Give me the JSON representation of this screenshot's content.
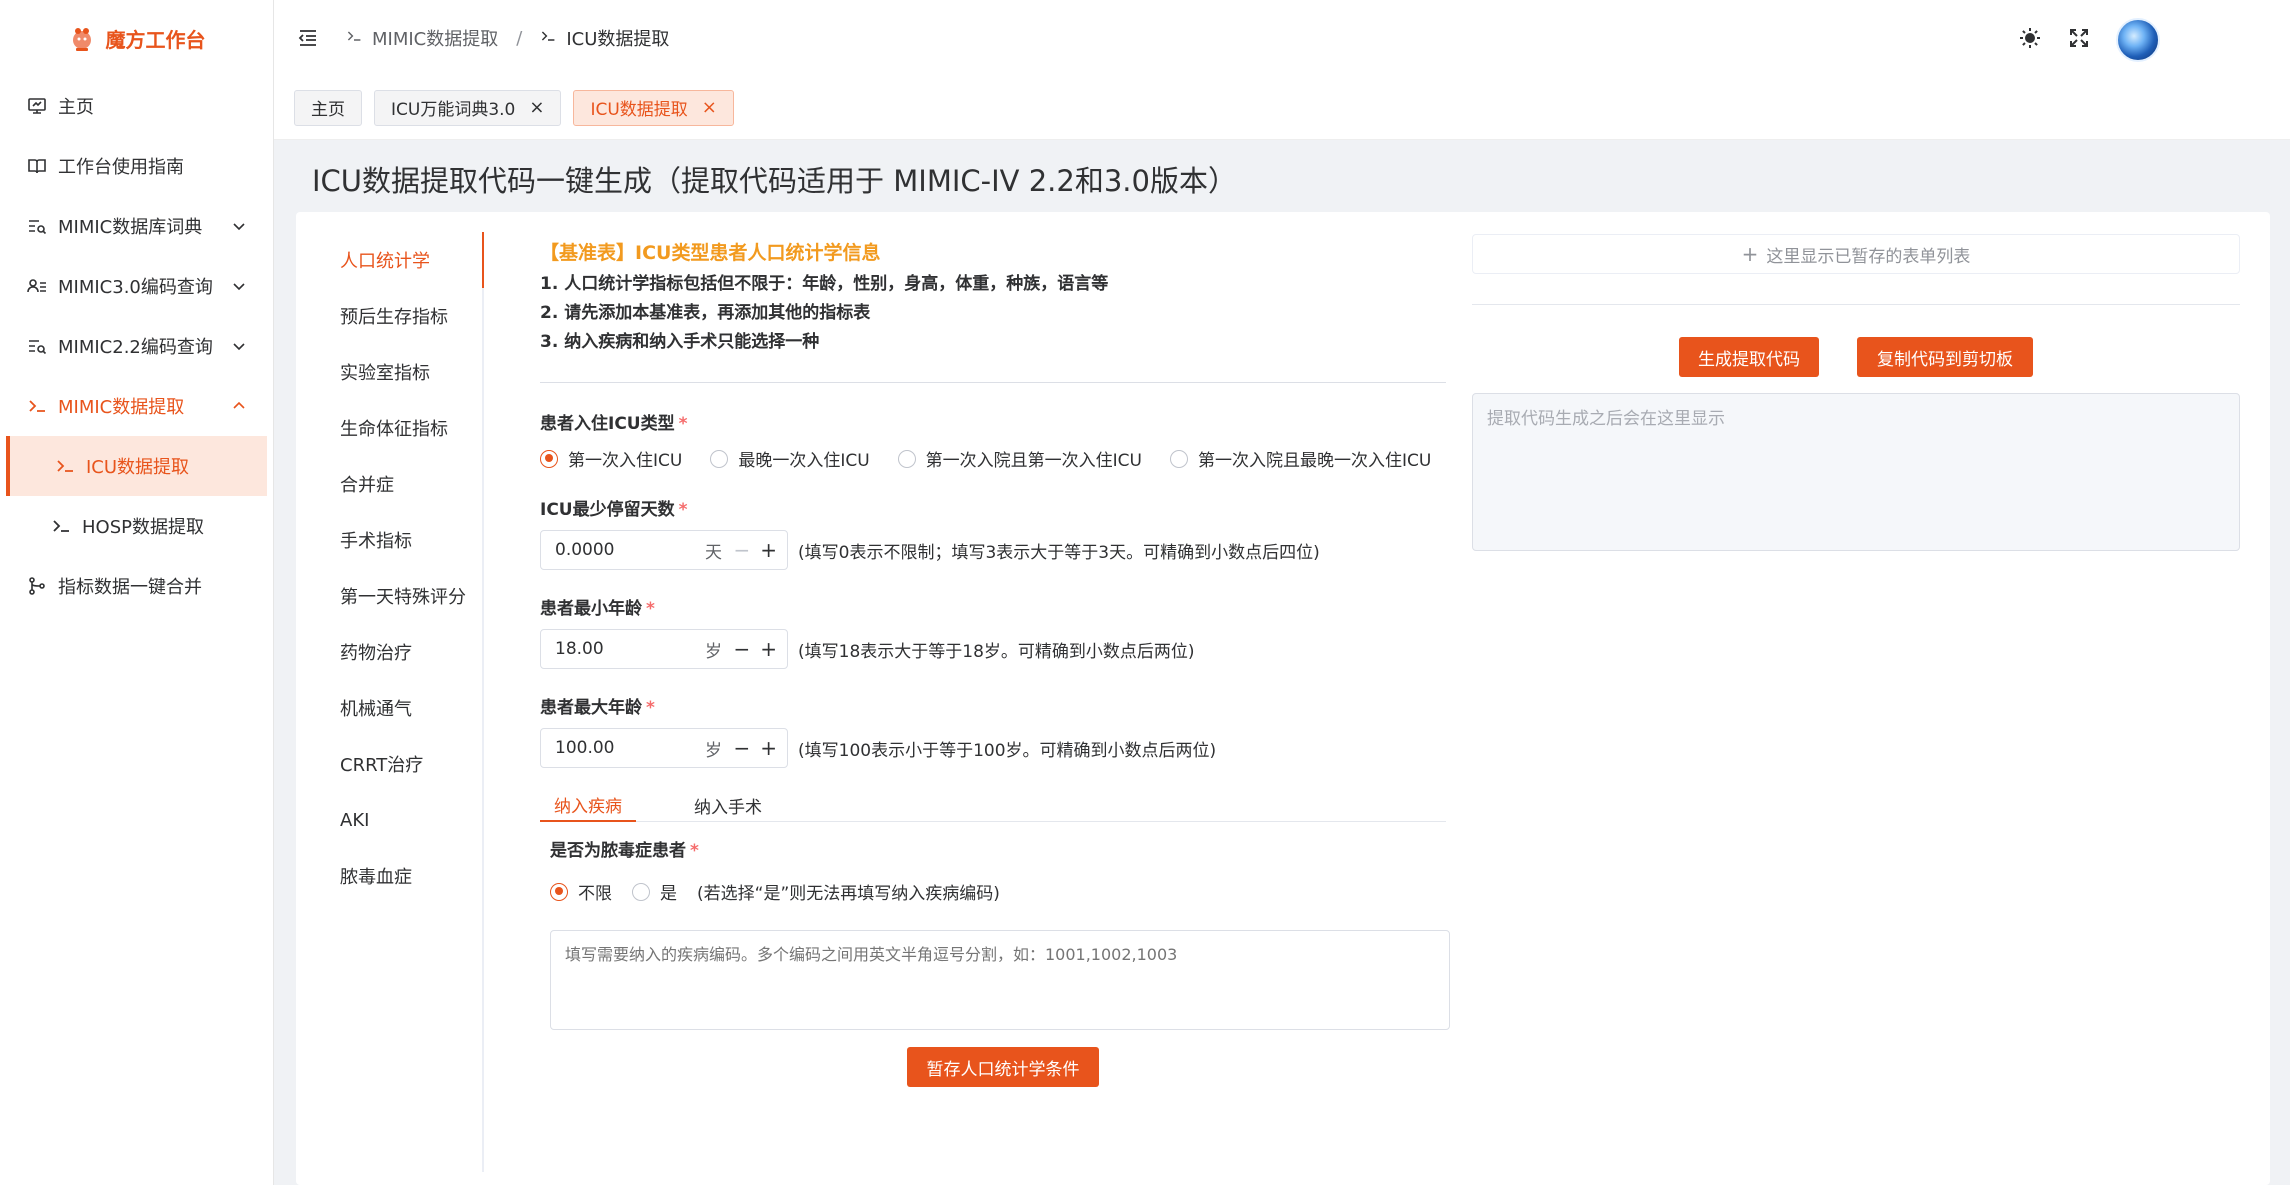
{
  "app": {
    "title": "魔方工作台"
  },
  "sidebar": {
    "items": [
      {
        "label": "主页"
      },
      {
        "label": "工作台使用指南"
      },
      {
        "label": "MIMIC数据库词典"
      },
      {
        "label": "MIMIC3.0编码查询"
      },
      {
        "label": "MIMIC2.2编码查询"
      },
      {
        "label": "MIMIC数据提取"
      },
      {
        "label": "ICU数据提取"
      },
      {
        "label": "HOSP数据提取"
      },
      {
        "label": "指标数据一键合并"
      }
    ]
  },
  "breadcrumb": {
    "items": [
      "MIMIC数据提取",
      "ICU数据提取"
    ],
    "separator": "/"
  },
  "tabs": [
    {
      "label": "主页"
    },
    {
      "label": "ICU万能词典3.0"
    },
    {
      "label": "ICU数据提取"
    }
  ],
  "page": {
    "title": "ICU数据提取代码一键生成（提取代码适用于 MIMIC-IV 2.2和3.0版本）"
  },
  "left_nav": [
    "人口统计学",
    "预后生存指标",
    "实验室指标",
    "生命体征指标",
    "合并症",
    "手术指标",
    "第一天特殊评分",
    "药物治疗",
    "机械通气",
    "CRRT治疗",
    "AKI",
    "脓毒血症"
  ],
  "form": {
    "header": "【基准表】ICU类型患者人口统计学信息",
    "notes": [
      "1. 人口统计学指标包括但不限于：年龄，性别，身高，体重，种族，语言等",
      "2. 请先添加本基准表，再添加其他的指标表",
      "3. 纳入疾病和纳入手术只能选择一种"
    ],
    "icu_type": {
      "label": "患者入住ICU类型",
      "options": [
        "第一次入住ICU",
        "最晚一次入住ICU",
        "第一次入院且第一次入住ICU",
        "第一次入院且最晚一次入住ICU"
      ],
      "selected": 0
    },
    "min_stay": {
      "label": "ICU最少停留天数",
      "value": "0.0000",
      "unit": "天",
      "hint": "(填写0表示不限制；填写3表示大于等于3天。可精确到小数点后四位)"
    },
    "min_age": {
      "label": "患者最小年龄",
      "value": "18.00",
      "unit": "岁",
      "hint": "(填写18表示大于等于18岁。可精确到小数点后两位)"
    },
    "max_age": {
      "label": "患者最大年龄",
      "value": "100.00",
      "unit": "岁",
      "hint": "(填写100表示小于等于100岁。可精确到小数点后两位)"
    },
    "sub_tabs": [
      "纳入疾病",
      "纳入手术"
    ],
    "sepsis": {
      "label": "是否为脓毒症患者",
      "options": [
        "不限",
        "是"
      ],
      "selected": 0,
      "hint": "(若选择“是”则无法再填写纳入疾病编码)"
    },
    "disease_codes_placeholder": "填写需要纳入的疾病编码。多个编码之间用英文半角逗号分割，如：1001,1002,1003",
    "save_button": "暂存人口统计学条件"
  },
  "right_panel": {
    "saved_list_placeholder": "这里显示已暂存的表单列表",
    "generate_button": "生成提取代码",
    "copy_button": "复制代码到剪切板",
    "code_placeholder": "提取代码生成之后会在这里显示"
  },
  "colors": {
    "accent": "#e8541c",
    "header_orange": "#f29a1f",
    "required": "#f56c6c"
  }
}
